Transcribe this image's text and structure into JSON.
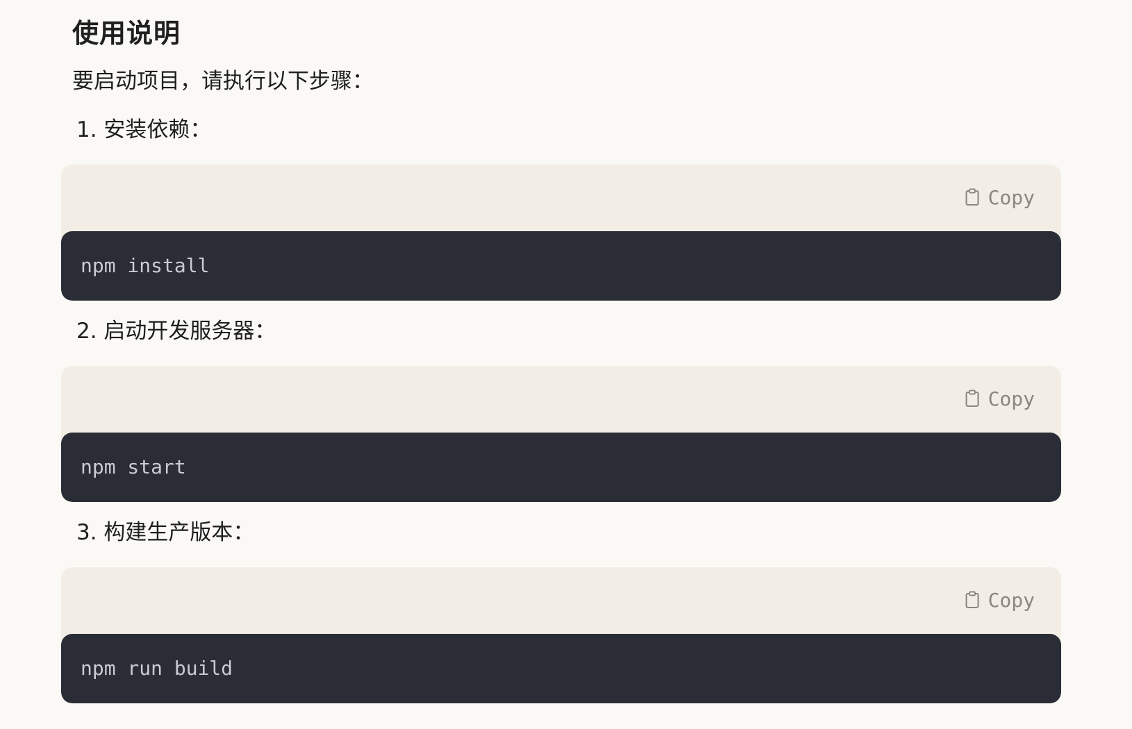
{
  "section": {
    "title": "使用说明",
    "intro": "要启动项目，请执行以下步骤："
  },
  "steps": [
    {
      "label": "1. 安装依赖：",
      "code": "npm install",
      "copy_label": "Copy",
      "copy_icon": "clipboard-icon"
    },
    {
      "label": "2. 启动开发服务器：",
      "code": "npm start",
      "copy_label": "Copy",
      "copy_icon": "clipboard-icon"
    },
    {
      "label": "3. 构建生产版本：",
      "code": "npm run build",
      "copy_label": "Copy",
      "copy_icon": "clipboard-icon"
    }
  ],
  "colors": {
    "page_background": "#faf9f6",
    "code_header_background": "#f2eee6",
    "code_background": "#2a2d35",
    "code_text": "#c9cbd0",
    "copy_text": "#8a8780"
  }
}
